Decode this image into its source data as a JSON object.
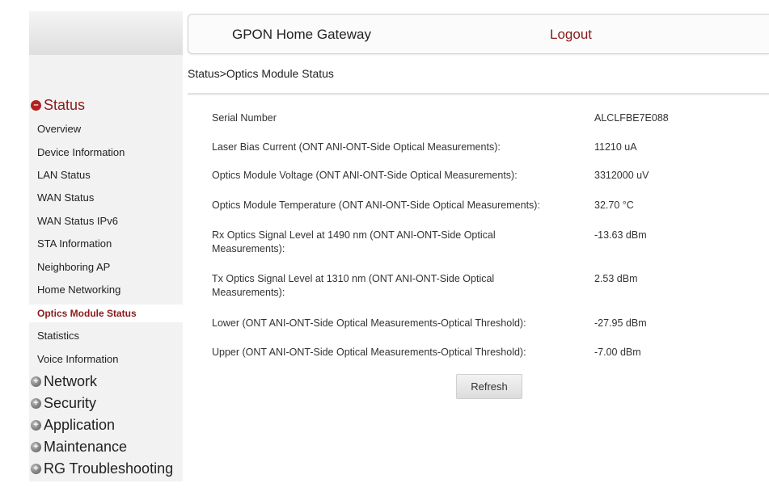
{
  "header": {
    "title": "GPON Home Gateway",
    "logout_label": "Logout"
  },
  "sidebar": {
    "status_group": {
      "label": "Status",
      "items": [
        "Overview",
        "Device Information",
        "LAN Status",
        "WAN Status",
        "WAN Status IPv6",
        "STA Information",
        "Neighboring AP",
        "Home Networking",
        "Optics Module Status",
        "Statistics",
        "Voice Information"
      ],
      "active_item": "Optics Module Status"
    },
    "collapsed_groups": [
      "Network",
      "Security",
      "Application",
      "Maintenance",
      "RG Troubleshooting"
    ]
  },
  "breadcrumb": "Status>Optics Module Status",
  "rows": [
    {
      "label": "Serial Number",
      "value": "ALCLFBE7E088"
    },
    {
      "label": "Laser Bias Current (ONT ANI-ONT-Side Optical Measurements):",
      "value": "11210 uA"
    },
    {
      "label": "Optics Module Voltage (ONT ANI-ONT-Side Optical Measurements):",
      "value": "3312000 uV"
    },
    {
      "label": "Optics Module Temperature (ONT ANI-ONT-Side Optical Measurements):",
      "value": "32.70 °C"
    },
    {
      "label": "Rx Optics Signal Level at 1490 nm (ONT ANI-ONT-Side Optical Measurements):",
      "value": "-13.63 dBm"
    },
    {
      "label": "Tx Optics Signal Level at 1310 nm (ONT ANI-ONT-Side Optical Measurements):",
      "value": "2.53 dBm"
    },
    {
      "label": "Lower (ONT ANI-ONT-Side Optical Measurements-Optical Threshold):",
      "value": "-27.95 dBm"
    },
    {
      "label": "Upper (ONT ANI-ONT-Side Optical Measurements-Optical Threshold):",
      "value": "-7.00 dBm"
    }
  ],
  "refresh_label": "Refresh",
  "colors": {
    "accent": "#8b1a1a",
    "sidebar_bg": "#f2f2f2"
  },
  "icons": {
    "status_group": "minus-circle-icon",
    "collapsed_group": "plus-circle-icon"
  }
}
